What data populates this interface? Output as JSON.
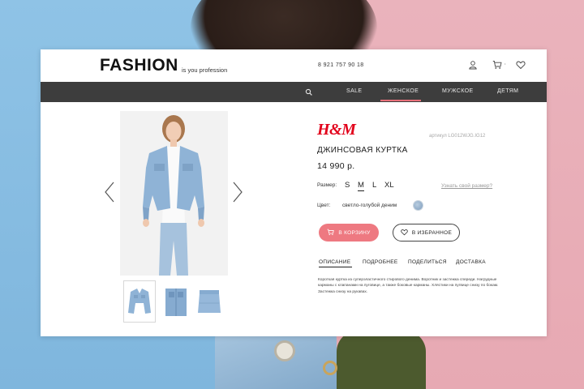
{
  "header": {
    "logo": "FASHION",
    "tagline": "is you profession",
    "phone": "8 921 757 90 18",
    "icons": [
      "user-icon",
      "cart-icon",
      "heart-icon"
    ]
  },
  "nav": {
    "items": [
      {
        "label": "SALE"
      },
      {
        "label": "ЖЕНСКОЕ",
        "active": true
      },
      {
        "label": "МУЖСКОЕ"
      },
      {
        "label": "ДЕТЯМ"
      }
    ]
  },
  "product": {
    "brand": "H&M",
    "sku": "артикул LG012WJG.IG12",
    "title": "ДЖИНСОВАЯ КУРТКА",
    "price": "14 990 р.",
    "size_label": "Размер:",
    "sizes": [
      "S",
      "M",
      "L",
      "XL"
    ],
    "selected_size": "M",
    "size_link": "Узнать свой размер?",
    "color_label": "Цвет:",
    "color_value": "светло-голубой деним",
    "add_to_cart": "В КОРЗИНУ",
    "add_to_favorites": "В ИЗБРАННОЕ",
    "tabs": [
      "ОПИСАНИЕ",
      "ПОДРОБНЕЕ",
      "ПОДЕЛИТЬСЯ",
      "ДОСТАВКА"
    ],
    "active_tab": "ОПИСАНИЕ",
    "description": "Короткая куртка из суперэластичного стирового денима. Воротник и застежка спереди. Нагрудные карманы с клапанами на пуговице, а также боковые карманы. Хлястики на пугвице снизу по бокам. Застежка снизу на рукавах."
  },
  "colors": {
    "accent": "#ee7981",
    "nav_bg": "#3d3d3d",
    "brand_red": "#e2001a"
  }
}
